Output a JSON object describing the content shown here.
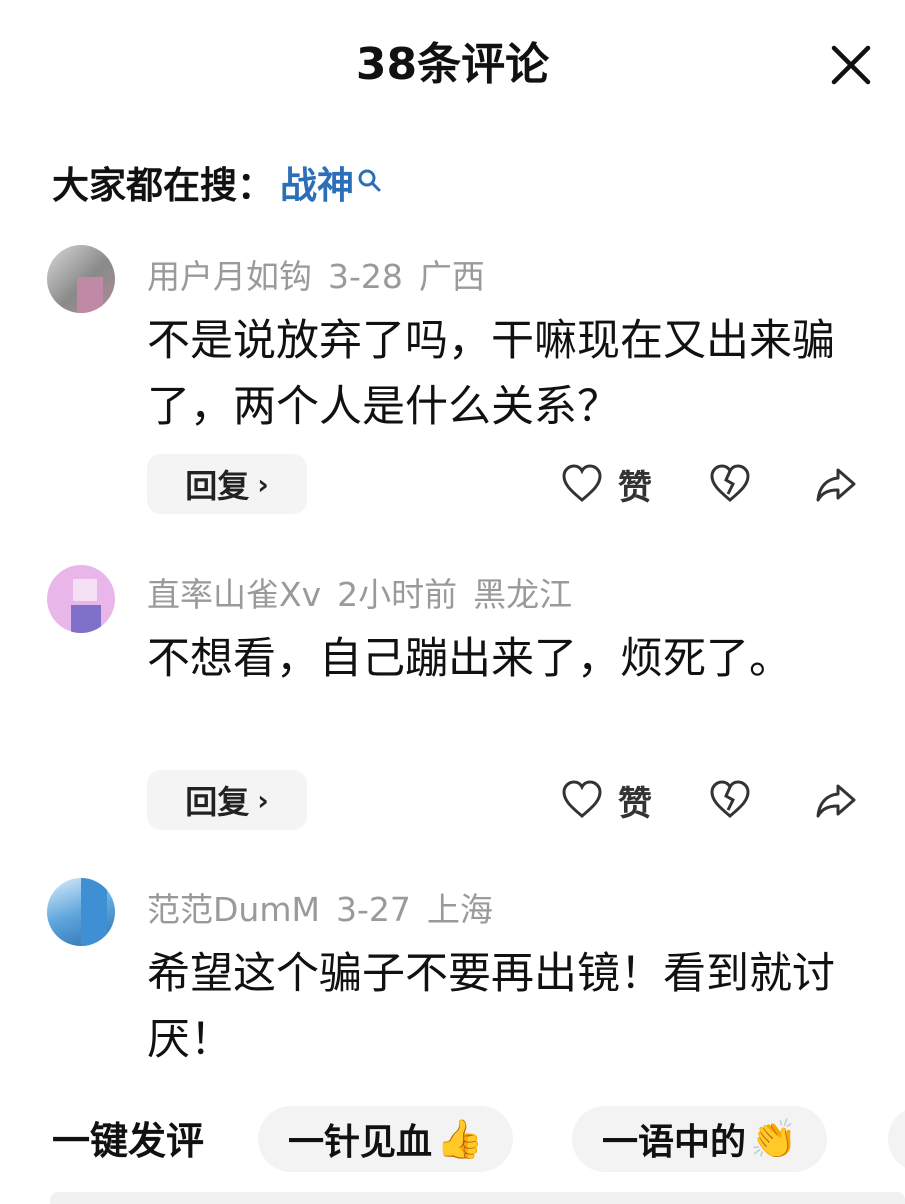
{
  "header": {
    "title": "38条评论"
  },
  "search": {
    "prefix": "大家都在搜：",
    "term": "战神"
  },
  "comments": [
    {
      "user": "用户月如钩",
      "time": "3-28",
      "region": "广西",
      "text": "不是说放弃了吗，干嘛现在又出来骗了，两个人是什么关系？",
      "reply": "回复",
      "like": "赞"
    },
    {
      "user": "直率山雀Xv",
      "time": "2小时前",
      "region": "黑龙江",
      "text": "不想看，自己蹦出来了，烦死了。",
      "reply": "回复",
      "like": "赞"
    },
    {
      "user": "范范DumM",
      "time": "3-27",
      "region": "上海",
      "text": "希望这个骗子不要再出镜！看到就讨厌！"
    }
  ],
  "quick": {
    "label": "一键发评",
    "chips": [
      {
        "text": "一针见血",
        "emoji": "👍"
      },
      {
        "text": "一语中的",
        "emoji": "👏"
      }
    ]
  },
  "colors": {
    "accent": "#2a6fb7",
    "meta": "#9a9a9a",
    "chip_bg": "#f3f3f3"
  },
  "icons": [
    "close-icon",
    "search-icon",
    "heart-icon",
    "broken-heart-icon",
    "share-icon"
  ]
}
